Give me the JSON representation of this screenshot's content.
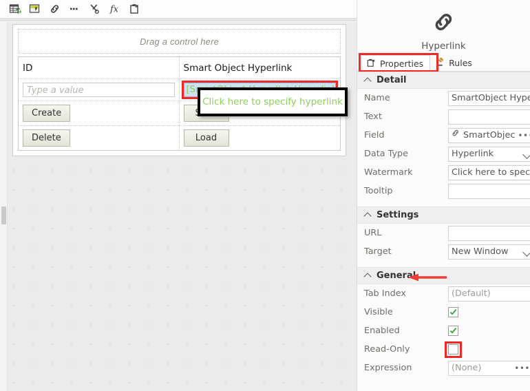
{
  "toolbar": {
    "buttons": [
      {
        "name": "view-properties-icon",
        "title": "View"
      },
      {
        "name": "theme-paint-icon",
        "title": "Theme"
      },
      {
        "name": "link-icon",
        "title": "Link"
      },
      {
        "name": "more-icon",
        "title": "More"
      },
      {
        "name": "cut-rule-icon",
        "title": "Rule"
      },
      {
        "name": "function-icon",
        "title": "Function"
      },
      {
        "name": "paste-icon",
        "title": "Paste"
      }
    ]
  },
  "designer": {
    "drop_zone_label": "Drag a control here",
    "rows": [
      {
        "left_label": "ID",
        "right_label": "Smart Object Hyperlink"
      }
    ],
    "id_input_placeholder": "Type a value",
    "hyperlink_field_value": "[SmartObject Hyperlink Hyperlink]",
    "buttons": {
      "create": "Create",
      "delete": "Delete",
      "save": "Save",
      "load": "Load"
    }
  },
  "callout": {
    "text": "Click here to specify hyperlink"
  },
  "properties_panel": {
    "header": {
      "icon": "hyperlink-chain-icon",
      "title": "Hyperlink"
    },
    "tabs": [
      {
        "label": "Properties",
        "icon": "properties-icon",
        "active": true
      },
      {
        "label": "Rules",
        "icon": "gavel-icon",
        "active": false
      }
    ],
    "sections": [
      {
        "title": "Detail",
        "rows": [
          {
            "name": "Name",
            "value": "SmartObject Hyperl",
            "type": "text"
          },
          {
            "name": "Text",
            "value": "",
            "type": "text"
          },
          {
            "name": "Field",
            "value": "SmartObjec",
            "type": "picker",
            "icon": "hyperlink-chain-icon"
          },
          {
            "name": "Data Type",
            "value": "Hyperlink",
            "type": "select"
          },
          {
            "name": "Watermark",
            "value": "Click here to specify",
            "type": "text"
          },
          {
            "name": "Tooltip",
            "value": "",
            "type": "text"
          }
        ]
      },
      {
        "title": "Settings",
        "rows": [
          {
            "name": "URL",
            "value": "",
            "type": "text"
          },
          {
            "name": "Target",
            "value": "New Window",
            "type": "select"
          }
        ]
      },
      {
        "title": "General",
        "rows": [
          {
            "name": "Tab Index",
            "value": "(Default)",
            "type": "text",
            "placeholder": true
          },
          {
            "name": "Visible",
            "value": true,
            "type": "checkbox"
          },
          {
            "name": "Enabled",
            "value": true,
            "type": "checkbox"
          },
          {
            "name": "Read-Only",
            "value": false,
            "type": "checkbox",
            "highlight": true
          },
          {
            "name": "Expression",
            "value": "(None)",
            "type": "picker-plain",
            "placeholder": true
          }
        ]
      }
    ]
  },
  "annotations": {
    "highlight_color": "#ef2828",
    "callout_text_color": "#8ece5a",
    "arrow_color": "#ee3b33"
  }
}
